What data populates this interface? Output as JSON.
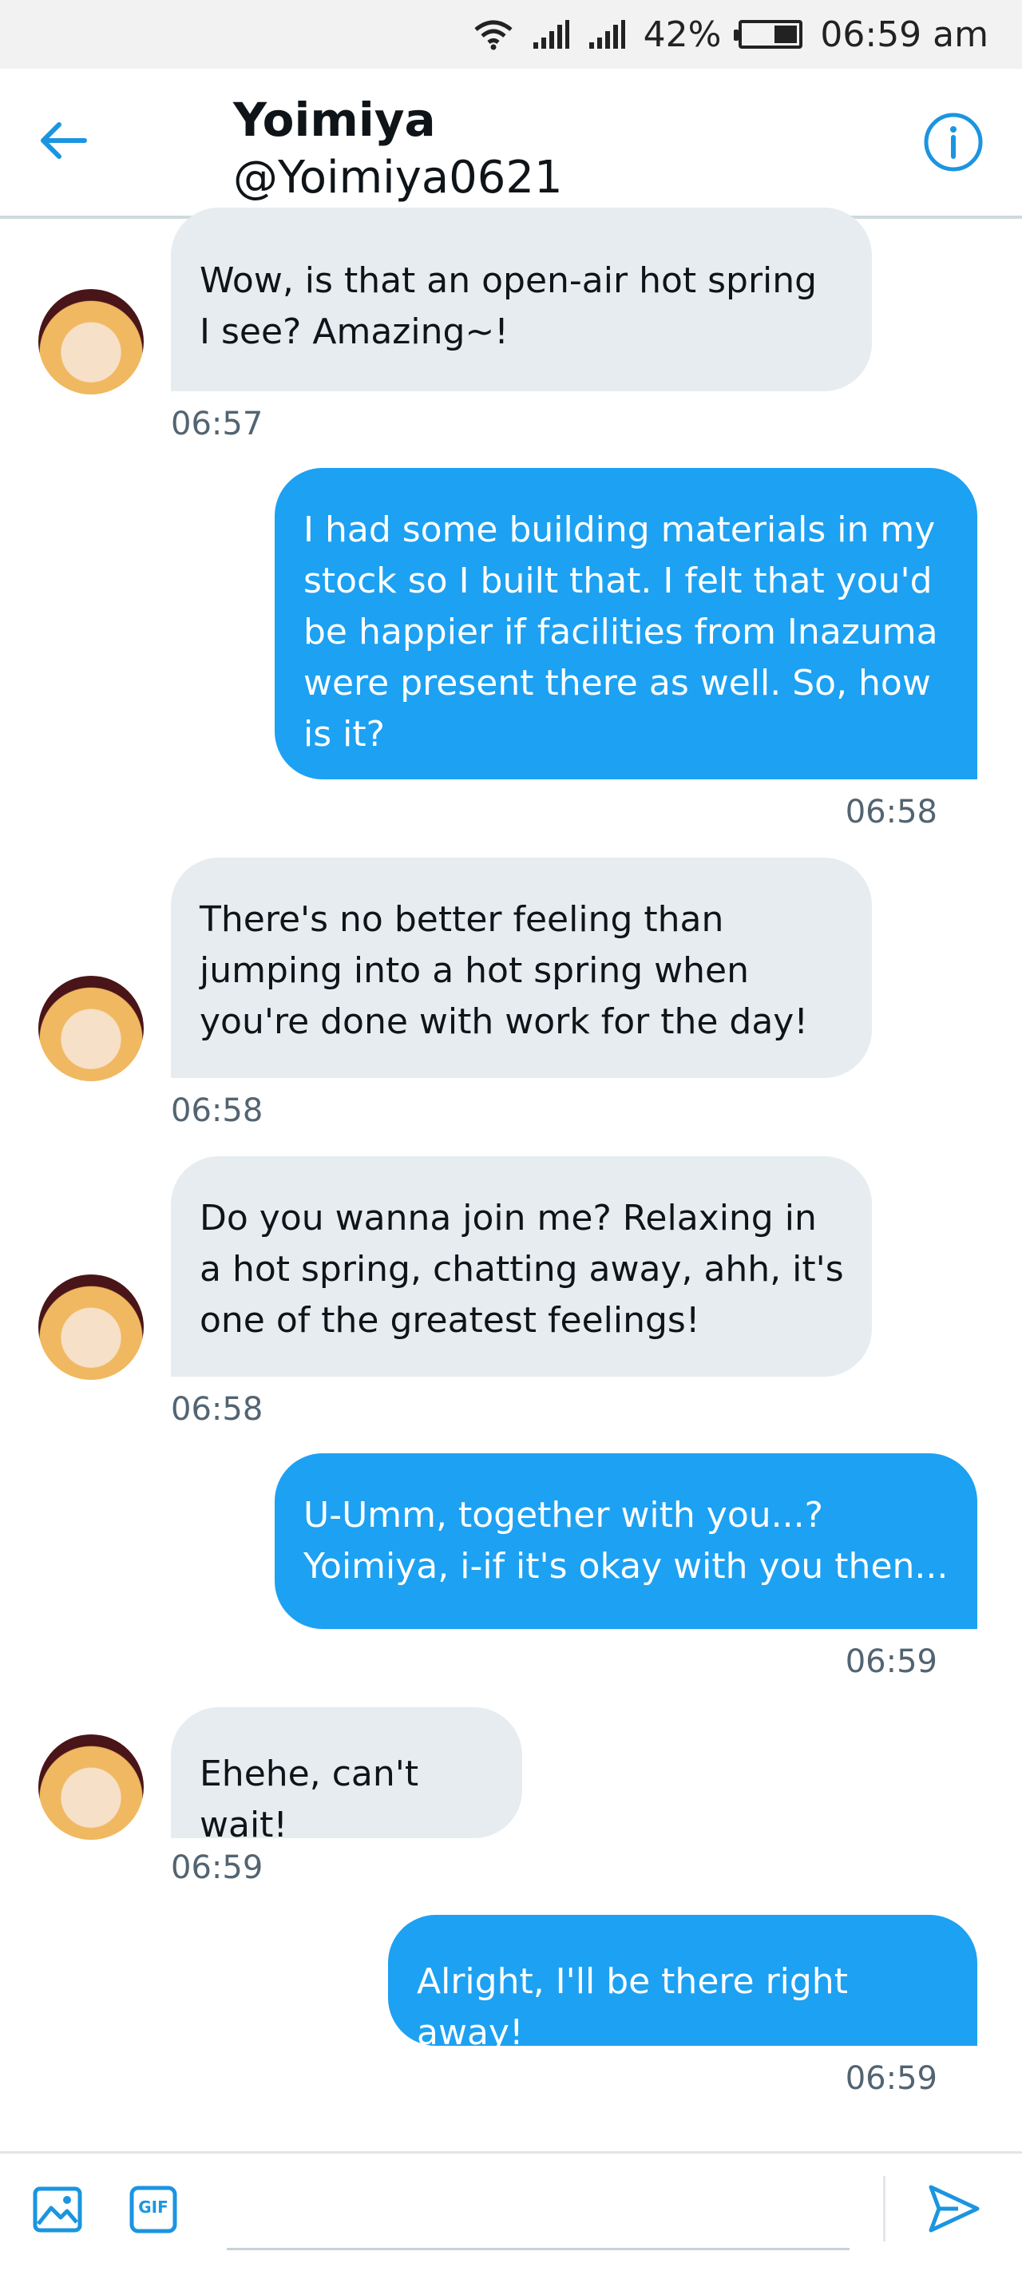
{
  "status_bar": {
    "wifi_icon": "wifi-icon",
    "signal_icon": "cell-signal-icon",
    "battery_percent": "42%",
    "battery_level": 0.42,
    "time": "06:59 am"
  },
  "header": {
    "name": "Yoimiya",
    "handle": "@Yoimiya0621",
    "back_icon": "arrow-left-icon",
    "info_icon": "info-icon",
    "accent_color": "#1b95e0"
  },
  "messages": [
    {
      "direction": "received",
      "lines": [
        "Wow, is that an open-air hot spring",
        "I see? Amazing~!"
      ],
      "time": "06:57"
    },
    {
      "direction": "sent",
      "lines": [
        "I had some building materials in my",
        "stock so I built that. I felt that you'd",
        "be happier if facilities from Inazuma",
        "were present there as well. So, how",
        "is it?"
      ],
      "time": "06:58"
    },
    {
      "direction": "received",
      "lines": [
        "There's no better feeling than",
        "jumping into a hot spring when",
        "you're done with work for the day!"
      ],
      "time": "06:58"
    },
    {
      "direction": "received",
      "lines": [
        "Do you wanna join me? Relaxing in",
        "a hot spring, chatting away, ahh, it's",
        "one of the greatest feelings!"
      ],
      "time": "06:58"
    },
    {
      "direction": "sent",
      "lines": [
        "U-Umm, together with you...?",
        "Yoimiya, i-if it's okay with you then..."
      ],
      "time": "06:59"
    },
    {
      "direction": "received",
      "lines": [
        "Ehehe, can't wait!"
      ],
      "time": "06:59"
    },
    {
      "direction": "sent",
      "lines": [
        "Alright, I'll be there right away!"
      ],
      "time": "06:59"
    }
  ],
  "composer": {
    "image_icon": "image-icon",
    "gif_label": "GIF",
    "input_value": "",
    "send_icon": "send-icon"
  },
  "colors": {
    "sent_bubble": "#1da1f2",
    "received_bubble": "#e6ecf0"
  }
}
